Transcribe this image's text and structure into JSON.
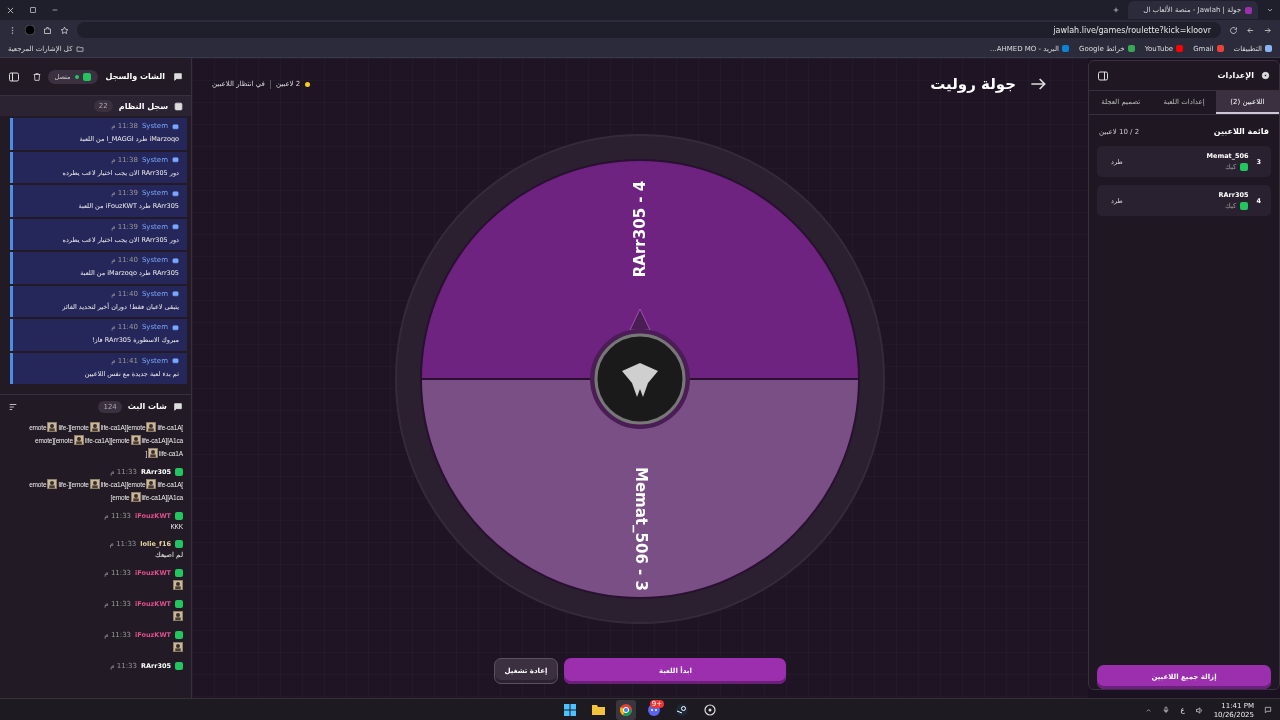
{
  "browser": {
    "tab_title": "جولة | Jawlah - منصة الألعاب ال",
    "url": "jawlah.live/games/roulette?kick=kloovr",
    "all_bookmarks": "كل الإشارات المرجعية",
    "bookmarks": [
      {
        "label": "التطبيقات",
        "color": "#8ab4f8"
      },
      {
        "label": "Gmail",
        "color": "#ea4335"
      },
      {
        "label": "YouTube",
        "color": "#ff0000"
      },
      {
        "label": "خرائط Google",
        "color": "#34a853"
      },
      {
        "label": "البريد - AHMED MO...",
        "color": "#0a84d8"
      }
    ]
  },
  "chat_panel": {
    "title": "الشات والسجل",
    "status": "متصل",
    "connected": true,
    "log": {
      "title": "سجل النظام",
      "count": "22",
      "entries": [
        {
          "sender": "System",
          "time": "11:38 م",
          "text": "iMarzoqo طرد I_MAGGI من اللعبة"
        },
        {
          "sender": "System",
          "time": "11:38 م",
          "text": "دور RArr305 الان يجب اختيار لاعب يطرده"
        },
        {
          "sender": "System",
          "time": "11:39 م",
          "text": "RArr305 طرد iFouzKWT من اللعبة"
        },
        {
          "sender": "System",
          "time": "11:39 م",
          "text": "دور RArr305 الان يجب اختيار لاعب يطرده"
        },
        {
          "sender": "System",
          "time": "11:40 م",
          "text": "RArr305 طرد iMarzoqo من اللعبة"
        },
        {
          "sender": "System",
          "time": "11:40 م",
          "text": "يتبقى لاعبان فقط! دوران أخير لتحديد الفائز"
        },
        {
          "sender": "System",
          "time": "11:40 م",
          "text": "مبروك الاسطورة RArr305 فاز!"
        },
        {
          "sender": "System",
          "time": "11:41 م",
          "text": "تم بدء لعبة جديدة مع نفس اللاعبين"
        }
      ]
    },
    "chat": {
      "title": "شات البث",
      "count": "124",
      "messages": [
        {
          "lines": [
            [
              {
                "kind": "text",
                "text": "life-ca1A["
              },
              {
                "kind": "emote"
              },
              {
                "kind": "text",
                "text": "life-ca1A][emote"
              },
              {
                "kind": "emote"
              },
              {
                "kind": "text",
                "text": "life-][emote"
              },
              {
                "kind": "emote"
              },
              {
                "kind": "text",
                "text": "emote"
              }
            ],
            [
              {
                "kind": "text",
                "text": "life-ca1A][A1ca"
              },
              {
                "kind": "emote"
              },
              {
                "kind": "text",
                "text": "life-ca1A][emote"
              },
              {
                "kind": "emote"
              },
              {
                "kind": "text",
                "text": "emote][emote"
              }
            ],
            [
              {
                "kind": "text",
                "text": "life-ca1A"
              },
              {
                "kind": "emote"
              },
              {
                "kind": "text",
                "text": "]"
              }
            ]
          ]
        },
        {
          "user": "RArr305",
          "color": "#ffffff",
          "time": "11:33 م",
          "lines": [
            [
              {
                "kind": "text",
                "text": "life-ca1A["
              },
              {
                "kind": "emote"
              },
              {
                "kind": "text",
                "text": "life-ca1A][emote"
              },
              {
                "kind": "emote"
              },
              {
                "kind": "text",
                "text": "life-][emote"
              },
              {
                "kind": "emote"
              },
              {
                "kind": "text",
                "text": "emote"
              }
            ],
            [
              {
                "kind": "text",
                "text": "life-ca1A][A1ca"
              },
              {
                "kind": "emote"
              },
              {
                "kind": "text",
                "text": "[emote"
              }
            ]
          ]
        },
        {
          "user": "iFouzKWT",
          "color": "#e0508a",
          "time": "11:33 م",
          "lines": [
            [
              {
                "kind": "text",
                "text": "KKK"
              }
            ]
          ]
        },
        {
          "user": "lolie_f16",
          "color": "#e8d6a0",
          "time": "11:33 م",
          "lines": [
            [
              {
                "kind": "text",
                "text": "لم اصيعك"
              }
            ]
          ]
        },
        {
          "user": "iFouzKWT",
          "color": "#e0508a",
          "time": "11:33 م",
          "lines": [
            [
              {
                "kind": "emote"
              }
            ]
          ]
        },
        {
          "user": "iFouzKWT",
          "color": "#e0508a",
          "time": "11:33 م",
          "lines": [
            [
              {
                "kind": "emote"
              }
            ]
          ]
        },
        {
          "user": "iFouzKWT",
          "color": "#e0508a",
          "time": "11:33 م",
          "lines": [
            [
              {
                "kind": "emote"
              }
            ]
          ]
        },
        {
          "user": "RArr305",
          "color": "#ffffff",
          "time": "11:33 م"
        }
      ]
    }
  },
  "game": {
    "title": "جولة روليت",
    "players": "2 لاعبين",
    "status": "في انتظار اللاعبين",
    "segments": [
      {
        "label": "RArr305 - 4",
        "color": "#6e2380"
      },
      {
        "label": "Memat_506 - 3",
        "color": "#7a4f86"
      }
    ],
    "restart_button": "إعادة تشغيل",
    "start_button": "ابدأ اللعبة"
  },
  "settings": {
    "title": "الإعدادات",
    "tabs": [
      {
        "label": "اللاعبين (2)",
        "selected": true
      },
      {
        "label": "إعدادات اللعبة",
        "selected": false
      },
      {
        "label": "تصميم العجلة",
        "selected": false
      }
    ],
    "list_title": "قائمة اللاعبين",
    "list_count": "2 / 10 لاعبين",
    "players": [
      {
        "number": "3",
        "name": "Memat_506",
        "platform": "كيك",
        "kick_button": "طرد"
      },
      {
        "number": "4",
        "name": "RArr305",
        "platform": "كيك",
        "kick_button": "طرد"
      }
    ],
    "remove_all_button": "إزالة جميع اللاعبين"
  },
  "taskbar": {
    "apps": [
      {
        "kind": "start",
        "selected": false
      },
      {
        "kind": "files",
        "selected": false
      },
      {
        "kind": "browser",
        "selected": true
      },
      {
        "kind": "chat",
        "selected": false,
        "badge": "9+"
      },
      {
        "kind": "steam",
        "selected": false
      },
      {
        "kind": "tool",
        "selected": false
      }
    ],
    "language": "ع",
    "time": "11:41 PM",
    "date": "10/26/2025"
  }
}
